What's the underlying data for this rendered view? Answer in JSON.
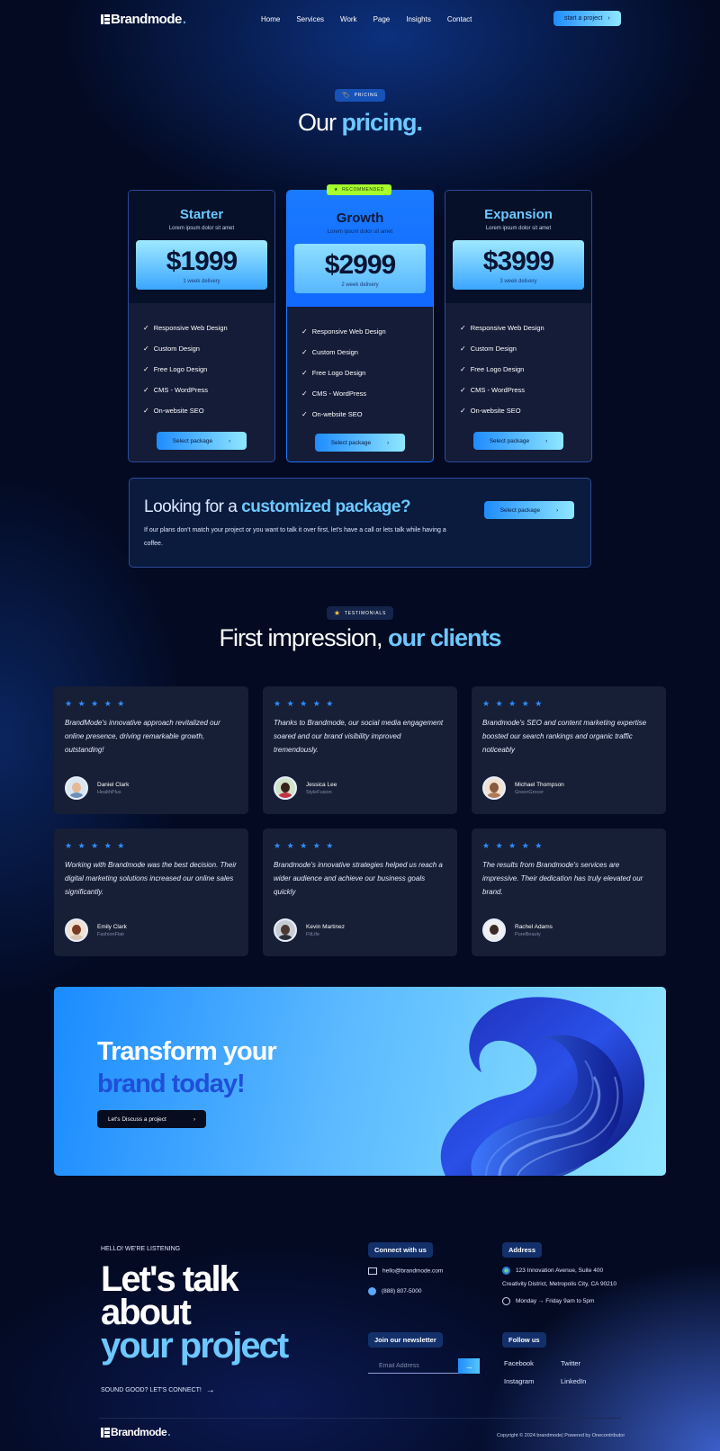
{
  "nav": {
    "logo": "Brandmode",
    "logo_dot": ".",
    "links": [
      "Home",
      "Services",
      "Work",
      "Page",
      "Insights",
      "Contact"
    ],
    "cta": "start a project"
  },
  "pricing": {
    "tag": "PRICING",
    "title_plain": "Our",
    "title_highlight": "pricing.",
    "recommended_label": "RECOMMENDED",
    "plans": [
      {
        "name": "Starter",
        "subtitle": "Lorem ipsum dolor sit amet",
        "price": "$1999",
        "delivery": "1 week delivery",
        "features": [
          "Responsive Web Design",
          "Custom Design",
          "Free Logo Design",
          "CMS - WordPress",
          "On-website SEO"
        ],
        "button": "Select package"
      },
      {
        "name": "Growth",
        "subtitle": "Lorem ipsum dolor sit amet",
        "price": "$2999",
        "delivery": "2 week delivery",
        "features": [
          "Responsive Web Design",
          "Custom Design",
          "Free Logo Design",
          "CMS - WordPress",
          "On-website SEO"
        ],
        "button": "Select package"
      },
      {
        "name": "Expansion",
        "subtitle": "Lorem ipsum dolor sit amet",
        "price": "$3999",
        "delivery": "3 week delivery",
        "features": [
          "Responsive Web Design",
          "Custom Design",
          "Free Logo Design",
          "CMS - WordPress",
          "On-website SEO"
        ],
        "button": "Select package"
      }
    ],
    "custom": {
      "title_plain": "Looking for a",
      "title_highlight": "customized package?",
      "description": "If our plans don't match your project or you want to talk it over first, let's have a call or lets talk while having a coffee.",
      "button": "Select package"
    }
  },
  "testimonials": {
    "tag": "TESTIMONIALS",
    "title_plain": "First impression,",
    "title_highlight": "our clients",
    "stars": "★ ★ ★ ★ ★",
    "items": [
      {
        "quote": "BrandMode's innovative approach revitalized our online presence, driving remarkable growth, outstanding!",
        "name": "Daniel Clark",
        "company": "HealthPlus"
      },
      {
        "quote": "Thanks to Brandmode, our social media engagement soared and our brand visibility improved tremendously.",
        "name": "Jessica Lee",
        "company": "StyleFusion"
      },
      {
        "quote": "Brandmode's SEO and content marketing expertise boosted our search rankings and organic traffic noticeably",
        "name": "Michael Thompson",
        "company": "GreenGrocer"
      },
      {
        "quote": "Working with Brandmode was the best decision. Their digital marketing solutions increased our online sales significantly.",
        "name": "Emily Clark",
        "company": "FashionFlair"
      },
      {
        "quote": "Brandmode's innovative strategies helped us reach a wider audience and achieve our business goals quickly",
        "name": "Kevin Martinez",
        "company": "FitLife"
      },
      {
        "quote": "The results from Brandmode's services are impressive. Their dedication has truly elevated our brand.",
        "name": "Rachel Adams",
        "company": "PureBeauty"
      }
    ]
  },
  "banner": {
    "line1": "Transform your",
    "line2": "brand today!",
    "button": "Let's Discuss a project"
  },
  "contact": {
    "eyebrow": "HELLO! WE'RE LISTENING",
    "line1": "Let's talk",
    "line2": "about",
    "line3": "your project",
    "cta": "SOUND GOOD? LET'S CONNECT!",
    "connect_title": "Connect with us",
    "email": "hello@brandmode.com",
    "phone": "(888) 807-5000",
    "address_title": "Address",
    "address_line1": "123 Innovation Avenue, Suite 400",
    "address_line2": "Creativity District, Metropolis City, CA 90210",
    "hours": "Monday → Friday 9am to 5pm",
    "newsletter_title": "Join our newsletter",
    "email_placeholder": "Email Address",
    "follow_title": "Follow us",
    "socials": [
      "Facebook",
      "Twitter",
      "Instagram",
      "LinkedIn"
    ]
  },
  "footer": {
    "logo": "Brandmode",
    "logo_dot": ".",
    "copyright": "Copyright © 2024 brandmode| Powered by Onecontributor"
  },
  "colors": {
    "accent": "#6cc8ff",
    "primary": "#1f8cff",
    "recommended": "#a6ff2c",
    "background": "#030a22"
  }
}
